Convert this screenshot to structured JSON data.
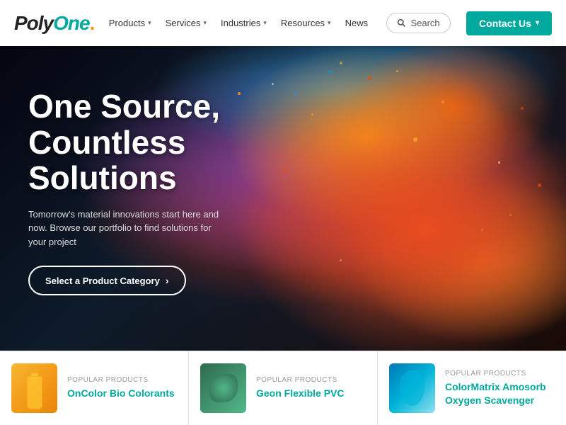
{
  "header": {
    "logo": "PolyOne",
    "nav": {
      "items": [
        {
          "label": "Products",
          "hasDropdown": true
        },
        {
          "label": "Services",
          "hasDropdown": true
        },
        {
          "label": "Industries",
          "hasDropdown": true
        },
        {
          "label": "Resources",
          "hasDropdown": true
        },
        {
          "label": "News",
          "hasDropdown": false
        }
      ]
    },
    "search": {
      "placeholder": "Search",
      "icon": "search-icon"
    },
    "contact": {
      "label": "Contact Us",
      "hasDropdown": true
    }
  },
  "hero": {
    "title": "One Source, Countless Solutions",
    "subtitle": "Tomorrow's material innovations start here and now. Browse our portfolio to find solutions for your project",
    "cta_label": "Select a Product Category"
  },
  "products": [
    {
      "label": "Popular Products",
      "name": "OnColor Bio Colorants",
      "thumb_type": "1"
    },
    {
      "label": "Popular Products",
      "name": "Geon Flexible PVC",
      "thumb_type": "2"
    },
    {
      "label": "Popular Products",
      "name": "ColorMatrix Amosorb Oxygen Scavenger",
      "thumb_type": "3"
    }
  ],
  "colors": {
    "teal": "#00a99d",
    "orange": "#f7941d",
    "dark": "#0a0a1a"
  }
}
